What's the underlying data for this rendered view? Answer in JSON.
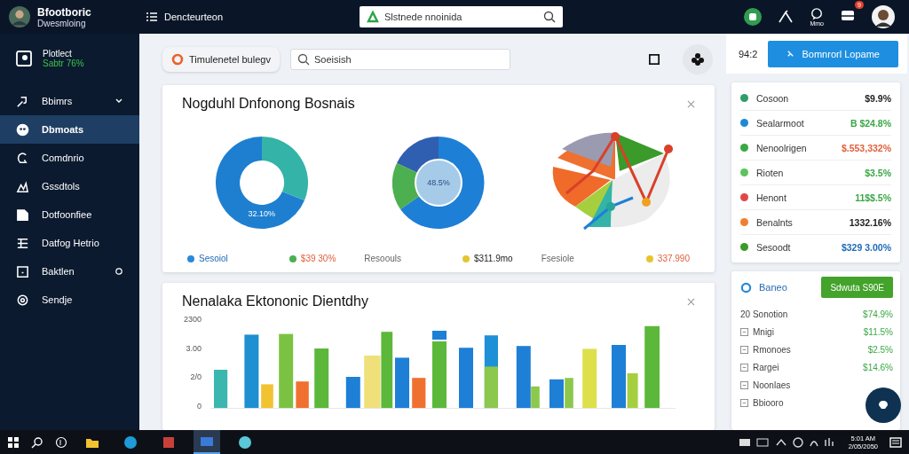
{
  "sidebar": {
    "brand": {
      "title": "Bfootboric",
      "subtitle": "Dwesmloing"
    },
    "profile": {
      "name": "Plotlect",
      "status": "Sabtr 76%"
    },
    "items": [
      {
        "label": "Bbimrs",
        "selected": false
      },
      {
        "label": "Dbmoats",
        "selected": true
      },
      {
        "label": "Comdnrio",
        "selected": false
      },
      {
        "label": "Gssdtols",
        "selected": false
      },
      {
        "label": "Dotfoonfiee",
        "selected": false
      },
      {
        "label": "Datfog Hetrio",
        "selected": false
      },
      {
        "label": "Baktlen",
        "selected": false
      },
      {
        "label": "Sendje",
        "selected": false
      }
    ]
  },
  "topbar": {
    "title": "Dencteurteon",
    "search": {
      "placeholder": "Slstnede nnoinida"
    },
    "chat_label": "Mmo",
    "notification_count": "9"
  },
  "toolbar": {
    "filter_label": "Timulenetel bulegv",
    "search": {
      "placeholder": "Soeisish"
    },
    "counter": "94:2",
    "primary_button": "Bomnrorl Lopame"
  },
  "summary_card": {
    "title": "Nogduhl Dnfonong Bosnais",
    "charts": [
      {
        "kind": "donut",
        "center_label": "32.10%",
        "legend": [
          {
            "text": "Sesoiol",
            "color": "#2a8ad8",
            "kind": "series"
          },
          {
            "text": "$39 30%",
            "color": "#4caf50",
            "kind": "loss"
          }
        ]
      },
      {
        "kind": "pie",
        "center_label": "48.5%",
        "legend": [
          {
            "text": "Resoouls",
            "kind": "plain"
          },
          {
            "text": "$311.9mo",
            "color": "#e6c430",
            "kind": "neutral"
          }
        ]
      },
      {
        "kind": "radial",
        "legend": [
          {
            "text": "Fsesiole",
            "kind": "plain"
          },
          {
            "text": "337.990",
            "color": "#e6c430",
            "kind": "loss"
          }
        ]
      }
    ]
  },
  "activity_card": {
    "title": "Nenalaka Ektononic Dientdhy",
    "y_labels": [
      "2300",
      "3.00",
      "2/0",
      "0"
    ]
  },
  "right_list": [
    {
      "label": "Cosoon",
      "value": "$9.9%",
      "color": "#2e9d6a",
      "kind": "neutral"
    },
    {
      "label": "Sealarmoot",
      "value": "B $24.8%",
      "color": "#1e88d6",
      "kind": "gain"
    },
    {
      "label": "Nenoolrigen",
      "value": "$.553,332%",
      "color": "#3aa745",
      "kind": "loss"
    },
    {
      "label": "Rioten",
      "value": "$3.5%",
      "color": "#5cc45c",
      "kind": "gain"
    },
    {
      "label": "Henont",
      "value": "11$$.5%",
      "color": "#e04848",
      "kind": "gain"
    },
    {
      "label": "Benalnts",
      "value": "1332.16%",
      "color": "#f08030",
      "kind": "neutral"
    },
    {
      "label": "Sesoodt",
      "value": "$329 3.00%",
      "color": "#3a9a2a",
      "kind": "series"
    }
  ],
  "goals_card": {
    "title": "Baneo",
    "button": "Sdwuta S90E",
    "rows": [
      {
        "label": "20 Sonotion",
        "value": "$74.9%"
      },
      {
        "label": "Mnigi",
        "value": "$11.5%"
      },
      {
        "label": "Rmonoes",
        "value": "$2.5%"
      },
      {
        "label": "Rargei",
        "value": "$14.6%"
      },
      {
        "label": "Noonlaes"
      },
      {
        "label": "Bbiooro"
      }
    ]
  },
  "taskbar": {
    "apps": [
      {
        "selected": false
      },
      {
        "selected": false
      },
      {
        "selected": false
      },
      {
        "selected": true
      },
      {
        "selected": false
      }
    ],
    "time": "5:01 AM",
    "date": "2/05/2050"
  }
}
